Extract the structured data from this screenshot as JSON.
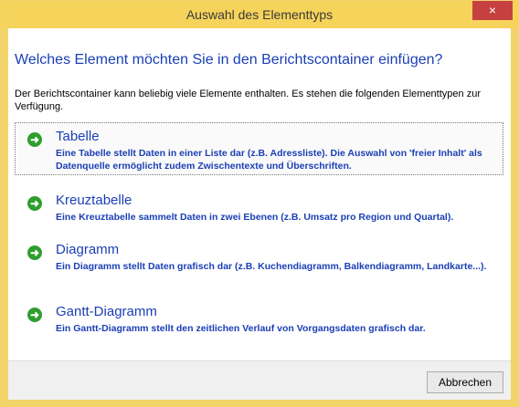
{
  "window": {
    "title": "Auswahl des Elementtyps",
    "close_label": "×"
  },
  "dialog": {
    "heading": "Welches Element möchten Sie in den Berichtscontainer einfügen?",
    "intro": "Der Berichtscontainer kann beliebig viele Elemente enthalten. Es stehen die folgenden Elementtypen zur Verfügung.",
    "options": [
      {
        "title": "Tabelle",
        "description": "Eine Tabelle stellt Daten in einer Liste dar (z.B. Adressliste). Die Auswahl von 'freier Inhalt' als Datenquelle ermöglicht zudem Zwischentexte und Überschriften.",
        "icon": "green-arrow-icon",
        "focused": true
      },
      {
        "title": "Kreuztabelle",
        "description": "Eine Kreuztabelle sammelt Daten in zwei Ebenen (z.B. Umsatz pro Region und Quartal).",
        "icon": "green-arrow-icon",
        "focused": false
      },
      {
        "title": "Diagramm",
        "description": "Ein Diagramm stellt Daten grafisch dar (z.B. Kuchendiagramm, Balkendiagramm, Landkarte...).",
        "icon": "green-arrow-icon",
        "focused": false
      },
      {
        "title": "Gantt-Diagramm",
        "description": "Ein Gantt-Diagramm stellt den zeitlichen Verlauf von Vorgangsdaten grafisch dar.",
        "icon": "green-arrow-icon",
        "focused": false
      }
    ],
    "cancel_label": "Abbrechen"
  },
  "colors": {
    "title_bar": "#f6d35a",
    "close_button": "#c74040",
    "heading_text": "#1a3fb5",
    "arrow_icon": "#2f9e2f"
  }
}
